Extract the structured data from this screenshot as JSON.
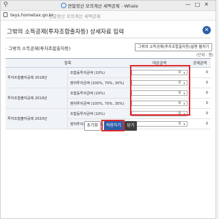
{
  "window": {
    "title": "연말정산 모의계산 세액공제 - Whale",
    "url_host": "teys.hometax.go.kr",
    "url_page": "연말정산 모의계산 세액공제",
    "buttons": [
      "—",
      "□",
      "✕"
    ]
  },
  "dialog": {
    "title": "그밖의 소득공제(투자조합출자등) 상세자료 입력",
    "close_icon": "close-icon",
    "section_title": "· 그밖의 소득공제(투자조합출자등)",
    "guide_button": "그밖의 소득공제(투자조합출자등)설명 펼치기",
    "unit": "(단위 : 원)"
  },
  "table": {
    "headers": [
      "항목",
      "대상금액",
      "공제금액"
    ],
    "groups": [
      {
        "label": "투자조합출자공제 2018년",
        "rows": [
          {
            "sub": "조합등투자금액 (10%)",
            "amount": "0",
            "deduction": "0"
          },
          {
            "sub": "벤처투자금액 (100%, 70%, 30%)",
            "amount": "0",
            "deduction": "0"
          }
        ]
      },
      {
        "label": "투자조합출자공제 2019년",
        "rows": [
          {
            "sub": "조합등투자금액 (10%)",
            "amount": "0",
            "deduction": "0"
          },
          {
            "sub": "벤처투자금액 (100%, 70%, 30%)",
            "amount": "0",
            "deduction": "0"
          }
        ]
      },
      {
        "label": "투자조합출자공제 2020년",
        "rows": [
          {
            "sub": "조합등투자금액 (10%)",
            "amount": "0",
            "deduction": "0"
          },
          {
            "sub": "벤처투자금액 (100%, 70%, 30%)",
            "amount": "0",
            "deduction": "0"
          }
        ]
      }
    ]
  },
  "actions": {
    "reset": "초기화",
    "apply": "적용하기",
    "close": "닫기"
  },
  "colors": {
    "accent": "#2c5fa8",
    "highlight": "#e0262b"
  }
}
